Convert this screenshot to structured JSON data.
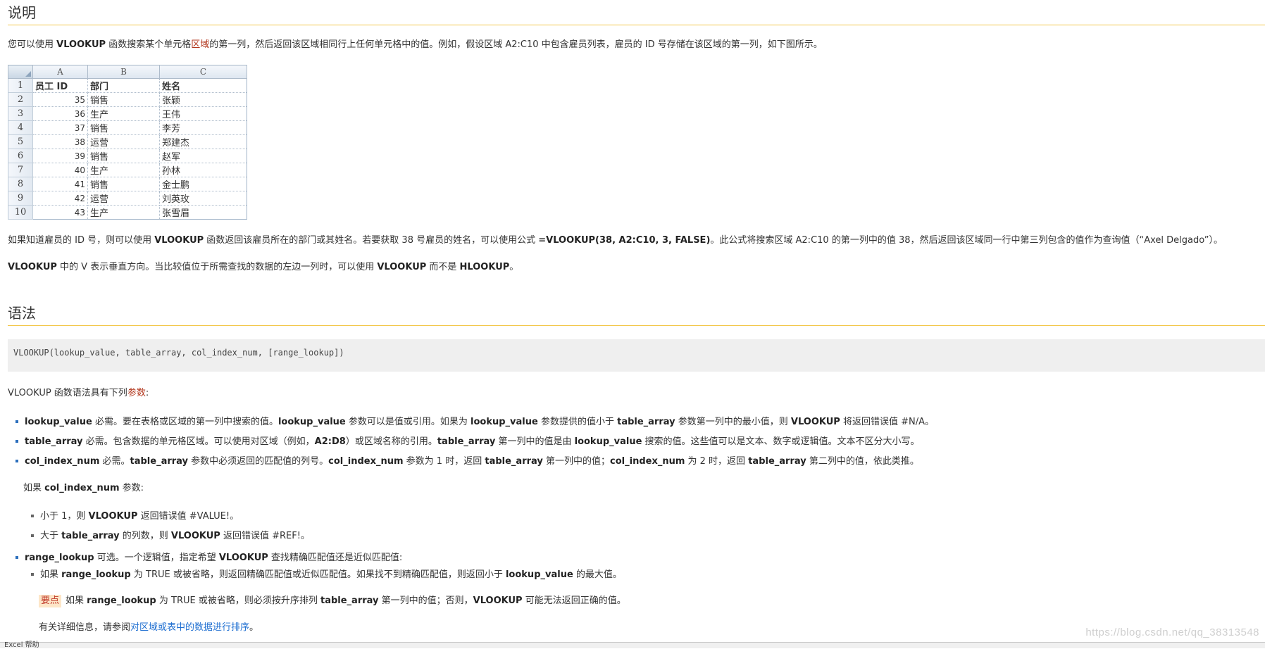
{
  "section1": {
    "title": "说明",
    "intro": {
      "p1": "您可以使用 ",
      "b1": "VLOOKUP",
      "p2": " 函数搜索某个单元格",
      "link": "区域",
      "p3": "的第一列，然后返回该区域相同行上任何单元格中的值。例如，假设区域 A2:C10 中包含雇员列表，雇员的 ID 号存储在该区域的第一列，如下图所示。"
    },
    "sheet": {
      "columns": [
        "A",
        "B",
        "C"
      ],
      "header": {
        "row": "1",
        "a": "员工 ID",
        "b": "部门",
        "c": "姓名"
      },
      "rows": [
        {
          "row": "2",
          "a": "35",
          "b": "销售",
          "c": "张颖"
        },
        {
          "row": "3",
          "a": "36",
          "b": "生产",
          "c": "王伟"
        },
        {
          "row": "4",
          "a": "37",
          "b": "销售",
          "c": "李芳"
        },
        {
          "row": "5",
          "a": "38",
          "b": "运营",
          "c": "郑建杰"
        },
        {
          "row": "6",
          "a": "39",
          "b": "销售",
          "c": "赵军"
        },
        {
          "row": "7",
          "a": "40",
          "b": "生产",
          "c": "孙林"
        },
        {
          "row": "8",
          "a": "41",
          "b": "销售",
          "c": "金士鹏"
        },
        {
          "row": "9",
          "a": "42",
          "b": "运营",
          "c": "刘英玫"
        },
        {
          "row": "10",
          "a": "43",
          "b": "生产",
          "c": "张雪眉"
        }
      ]
    },
    "para2": {
      "p1": "如果知道雇员的 ID 号，则可以使用 ",
      "b1": "VLOOKUP",
      "p2": " 函数返回该雇员所在的部门或其姓名。若要获取 38 号雇员的姓名，可以使用公式 ",
      "b2": "=VLOOKUP(38, A2:C10, 3, FALSE)",
      "p3": "。此公式将搜索区域 A2:C10 的第一列中的值 38，然后返回该区域同一行中第三列包含的值作为查询值（“Axel Delgado”）。"
    },
    "para3": {
      "b1": "VLOOKUP",
      "p1": " 中的 V 表示垂直方向。当比较值位于所需查找的数据的左边一列时，可以使用 ",
      "b2": "VLOOKUP",
      "p2": " 而不是 ",
      "b3": "HLOOKUP",
      "p3": "。"
    }
  },
  "section2": {
    "title": "语法",
    "code": "VLOOKUP(lookup_value, table_array, col_index_num, [range_lookup])",
    "args_intro": {
      "p1": "VLOOKUP 函数语法具有下列",
      "link": "参数",
      "p2": ":"
    },
    "arg1": {
      "name": "lookup_value",
      "p1": "  必需。要在表格或区域的第一列中搜索的值。",
      "b1": "lookup_value",
      "p2": " 参数可以是值或引用。如果为 ",
      "b2": "lookup_value",
      "p3": " 参数提供的值小于 ",
      "b3": "table_array",
      "p4": " 参数第一列中的最小值，则 ",
      "b4": "VLOOKUP",
      "p5": " 将返回错误值 #N/A。"
    },
    "arg2": {
      "name": "table_array",
      "p1": "  必需。包含数据的单元格区域。可以使用对区域（例如，",
      "b1": "A2:D8",
      "p2": "）或区域名称的引用。",
      "b2": "table_array",
      "p3": " 第一列中的值是由 ",
      "b3": "lookup_value",
      "p4": " 搜索的值。这些值可以是文本、数字或逻辑值。文本不区分大小写。"
    },
    "arg3": {
      "name": "col_index_num",
      "p1": "  必需。",
      "b1": "table_array",
      "p2": " 参数中必须返回的匹配值的列号。",
      "b2": "col_index_num",
      "p3": " 参数为 1 时，返回 ",
      "b3": "table_array",
      "p4": " 第一列中的值；",
      "b4": "col_index_num",
      "p5": " 为 2 时，返回 ",
      "b5": "table_array",
      "p6": " 第二列中的值，依此类推。"
    },
    "if_col": {
      "p1": "如果 ",
      "b1": "col_index_num",
      "p2": " 参数:"
    },
    "sub1": {
      "p1": "小于 1，则 ",
      "b1": "VLOOKUP",
      "p2": " 返回错误值 #VALUE!。"
    },
    "sub2": {
      "p1": "大于 ",
      "b1": "table_array",
      "p2": " 的列数，则 ",
      "b2": "VLOOKUP",
      "p3": " 返回错误值 #REF!。"
    },
    "arg4": {
      "name": "range_lookup",
      "p1": "  可选。一个逻辑值，指定希望 ",
      "b1": "VLOOKUP",
      "p2": " 查找精确匹配值还是近似匹配值:"
    },
    "sub3": {
      "p1": "如果 ",
      "b1": "range_lookup",
      "p2": " 为 TRUE 或被省略，则返回精确匹配值或近似匹配值。如果找不到精确匹配值，则返回小于 ",
      "b2": "lookup_value",
      "p3": " 的最大值。"
    },
    "important": {
      "tag": "要点",
      "p1": "如果 ",
      "b1": "range_lookup",
      "p2": " 为 TRUE 或被省略，则必须按升序排列 ",
      "b2": "table_array",
      "p3": " 第一列中的值；否则，",
      "b3": "VLOOKUP",
      "p4": " 可能无法返回正确的值。"
    },
    "more": {
      "p1": "有关详细信息，请参阅",
      "link": "对区域或表中的数据进行排序",
      "p2": "。"
    }
  },
  "watermark": "https://blog.csdn.net/qq_38313548",
  "footer": "Excel 帮助",
  "colors": {
    "rule": "#f3c74a",
    "link": "#1f6fd1",
    "bullet": "#2c6fbd",
    "important_bg": "#fde6c8"
  }
}
